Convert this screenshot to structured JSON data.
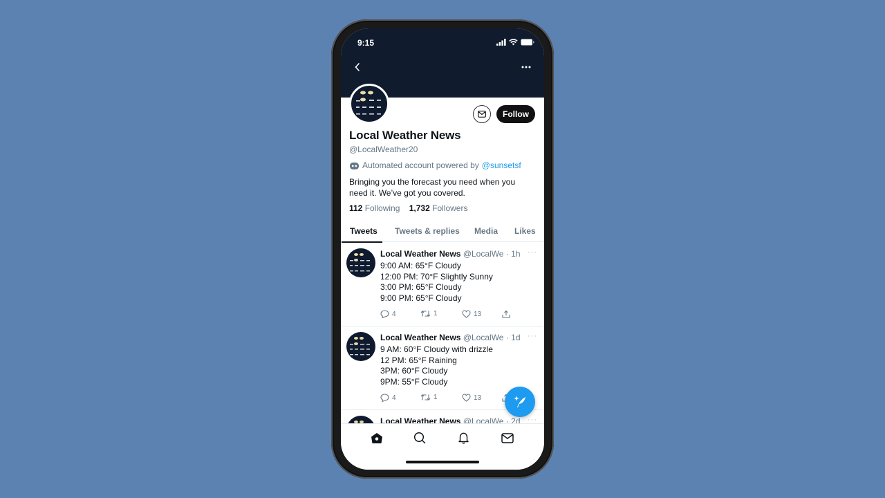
{
  "status_bar": {
    "time": "9:15"
  },
  "profile": {
    "name": "Local Weather News",
    "handle": "@LocalWeather20",
    "automated_prefix": "Automated account powered by",
    "automated_link": "@sunsetsf",
    "bio": "Bringing you the forecast you need when you need it.  We’ve got you covered.",
    "following_count": "112",
    "following_label": "Following",
    "followers_count": "1,732",
    "followers_label": "Followers",
    "follow_label": "Follow"
  },
  "tabs": [
    {
      "label": "Tweets",
      "active": true
    },
    {
      "label": "Tweets & replies",
      "active": false
    },
    {
      "label": "Media",
      "active": false
    },
    {
      "label": "Likes",
      "active": false
    }
  ],
  "tweets": [
    {
      "name": "Local Weather News",
      "meta": "@LocalWe · 1h",
      "lines": [
        "9:00 AM: 65°F Cloudy",
        "12:00 PM: 70°F Slightly Sunny",
        "3:00 PM: 65°F Cloudy",
        "9:00 PM: 65°F Cloudy"
      ],
      "replies": "4",
      "retweets": "1",
      "likes": "13"
    },
    {
      "name": "Local Weather News",
      "meta": "@LocalWe · 1d",
      "lines": [
        "9 AM: 60°F Cloudy with drizzle",
        "12 PM: 65°F Raining",
        "3PM: 60°F Cloudy",
        "9PM: 55°F Cloudy"
      ],
      "replies": "4",
      "retweets": "1",
      "likes": "13"
    },
    {
      "name": "Local Weather News",
      "meta": "@LocalWe · 2d"
    }
  ],
  "colors": {
    "accent": "#1d9bf0",
    "banner": "#111b2e",
    "background": "#5b82b0"
  }
}
